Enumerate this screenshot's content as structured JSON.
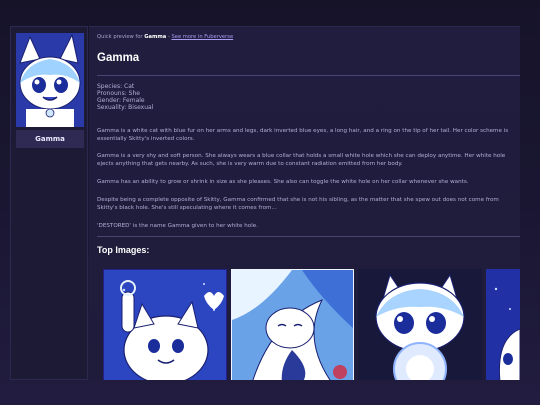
{
  "character": {
    "name": "Gamma",
    "avatar_icon": "character-avatar-icon"
  },
  "preview": {
    "prefix": "Quick preview for",
    "name": "Gamma",
    "separator": " - ",
    "link": "See more in Fuberverse"
  },
  "title": "Gamma",
  "meta": {
    "species": "Species: Cat",
    "pronouns": "Pronouns: She",
    "gender": "Gender: Female",
    "sexuality": "Sexuality: Bisexual"
  },
  "paragraphs": [
    "Gamma is a white cat with blue fur on her arms and legs, dark inverted blue eyes, a long hair, and a ring on the tip of her tail. Her color scheme is essentially Skitty's inverted colors.",
    "Gamma is a very shy and soft person. She always wears a blue collar that holds a small white hole which she can deploy anytime. Her white hole ejects anything that gets nearby. As such, she is very warm due to constant radiation emitted from her body.",
    "Gamma has an ability to grow or shrink in size as she pleases. She also can toggle the white hole on her collar whenever she wants.",
    "Despite being a complete opposite of Skitty, Gamma confirmed that she is not his sibling, as the matter that she spew out does not come from Skitty's black hole. She's still speculating where it comes from...",
    "'DESTORED' is the name Gamma given to her white hole."
  ],
  "top_images": {
    "heading": "Top Images:",
    "items": [
      {
        "name": "gamma-art-1"
      },
      {
        "name": "gamma-art-2"
      },
      {
        "name": "gamma-art-3"
      },
      {
        "name": "gamma-art-4"
      }
    ]
  },
  "colors": {
    "background": "#1b1734",
    "panel": "#211d3e",
    "accent_link": "#a99cf3",
    "fur_blue": "#2c45c0"
  }
}
